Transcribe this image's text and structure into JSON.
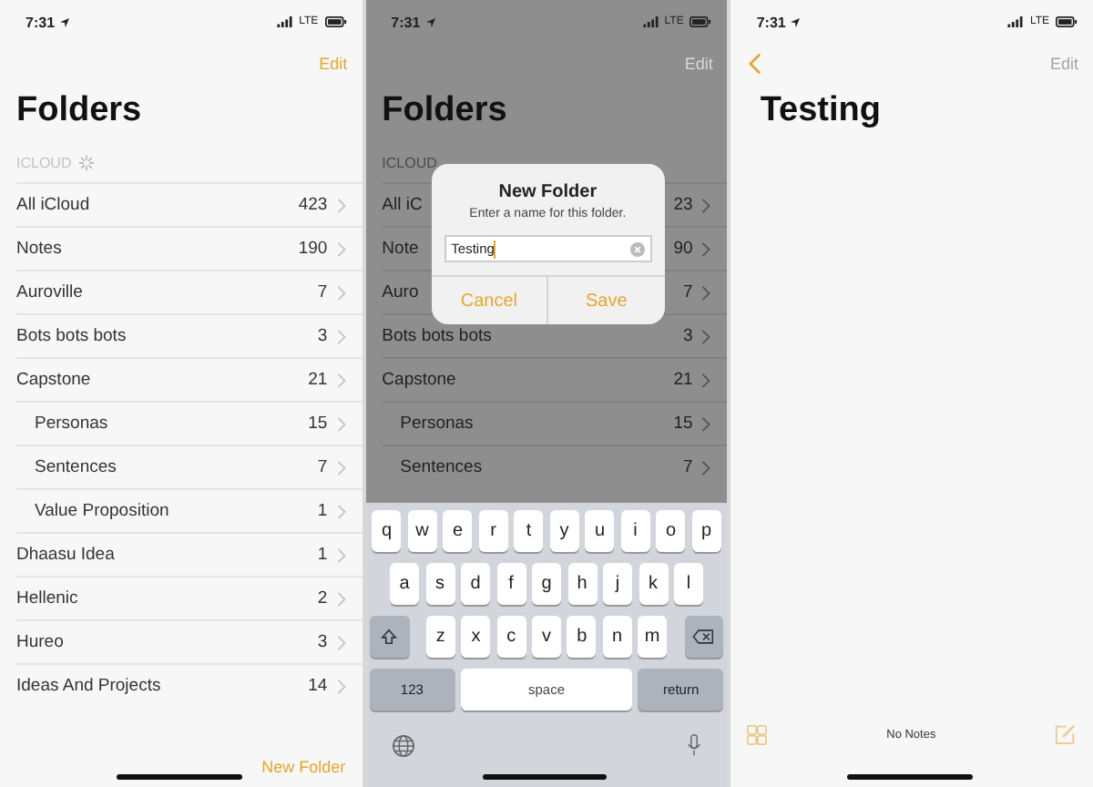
{
  "screens": [
    {
      "kind": "folders",
      "dimmed": false,
      "status_bar": {
        "time": "7:31",
        "network": "LTE"
      },
      "edit": {
        "label": "Edit",
        "disabled": false
      },
      "title": "Folders",
      "section": {
        "label": "ICLOUD",
        "loading": true
      },
      "folders": [
        {
          "name": "All iCloud",
          "count": "423"
        },
        {
          "name": "Notes",
          "count": "190"
        },
        {
          "name": "Auroville",
          "count": "7"
        },
        {
          "name": "Bots bots bots",
          "count": "3"
        },
        {
          "name": "Capstone",
          "count": "21",
          "children": [
            {
              "name": "Personas",
              "count": "15"
            },
            {
              "name": "Sentences",
              "count": "7"
            },
            {
              "name": "Value Proposition",
              "count": "1"
            }
          ]
        },
        {
          "name": "Dhaasu Idea",
          "count": "1"
        },
        {
          "name": "Hellenic",
          "count": "2"
        },
        {
          "name": "Hureo",
          "count": "3"
        },
        {
          "name": "Ideas And Projects",
          "count": "14"
        }
      ],
      "toolbar": {
        "new_folder": "New Folder"
      }
    },
    {
      "kind": "folders",
      "dimmed": true,
      "status_bar": {
        "time": "7:31",
        "network": "LTE"
      },
      "edit": {
        "label": "Edit",
        "disabled": true
      },
      "title": "Folders",
      "section": {
        "label": "ICLOUD",
        "loading": false
      },
      "folders": [
        {
          "name": "All iC",
          "count": "23"
        },
        {
          "name": "Note",
          "count": "90"
        },
        {
          "name": "Auro",
          "count": "7"
        },
        {
          "name": "Bots bots bots",
          "count": "3"
        },
        {
          "name": "Capstone",
          "count": "21",
          "children": [
            {
              "name": "Personas",
              "count": "15"
            },
            {
              "name": "Sentences",
              "count": "7"
            }
          ]
        }
      ],
      "dialog": {
        "title": "New Folder",
        "message": "Enter a name for this folder.",
        "value": "Testing",
        "cancel": "Cancel",
        "save": "Save"
      },
      "keyboard": {
        "keys": [
          {
            "kind": "letter",
            "label": "q"
          },
          {
            "kind": "letter",
            "label": "w"
          },
          {
            "kind": "letter",
            "label": "e"
          },
          {
            "kind": "letter",
            "label": "r"
          },
          {
            "kind": "letter",
            "label": "t"
          },
          {
            "kind": "letter",
            "label": "y"
          },
          {
            "kind": "letter",
            "label": "u"
          },
          {
            "kind": "letter",
            "label": "i"
          },
          {
            "kind": "letter",
            "label": "o"
          },
          {
            "kind": "letter",
            "label": "p"
          },
          {
            "kind": "letter",
            "label": "a"
          },
          {
            "kind": "letter",
            "label": "s"
          },
          {
            "kind": "letter",
            "label": "d"
          },
          {
            "kind": "letter",
            "label": "f"
          },
          {
            "kind": "letter",
            "label": "g"
          },
          {
            "kind": "letter",
            "label": "h"
          },
          {
            "kind": "letter",
            "label": "j"
          },
          {
            "kind": "letter",
            "label": "k"
          },
          {
            "kind": "letter",
            "label": "l"
          },
          {
            "kind": "shift"
          },
          {
            "kind": "letter",
            "label": "z"
          },
          {
            "kind": "letter",
            "label": "x"
          },
          {
            "kind": "letter",
            "label": "c"
          },
          {
            "kind": "letter",
            "label": "v"
          },
          {
            "kind": "letter",
            "label": "b"
          },
          {
            "kind": "letter",
            "label": "n"
          },
          {
            "kind": "letter",
            "label": "m"
          },
          {
            "kind": "delete"
          },
          {
            "kind": "mode",
            "label": "123"
          },
          {
            "kind": "space",
            "label": "space"
          },
          {
            "kind": "return",
            "label": "return"
          }
        ]
      }
    },
    {
      "kind": "folder",
      "dimmed": false,
      "status_bar": {
        "time": "7:31",
        "network": "LTE"
      },
      "edit": {
        "label": "Edit",
        "disabled": true
      },
      "title": "Testing",
      "toolbar": {
        "status": "No Notes"
      }
    }
  ]
}
